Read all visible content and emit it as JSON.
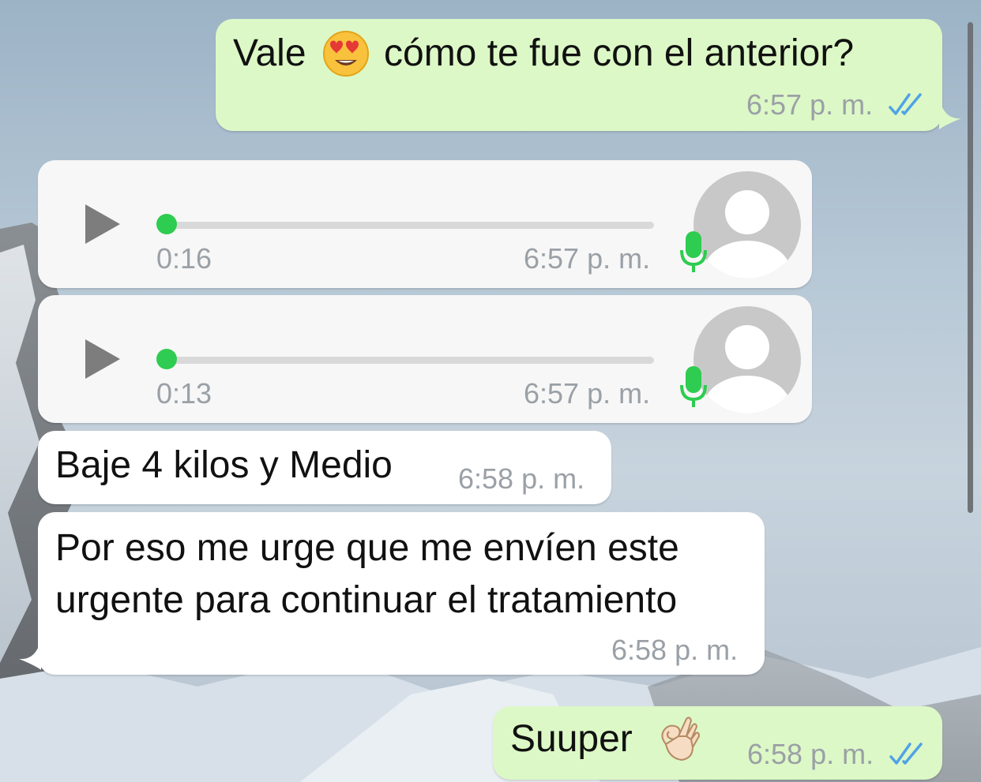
{
  "colors": {
    "outgoing_bubble": "#dcf8c6",
    "incoming_bubble": "#ffffff",
    "read_ticks": "#4fa3e6",
    "progress_dot": "#2ecc50",
    "mic_icon": "#2ecc50",
    "timestamp": "#9aa0a6"
  },
  "messages": [
    {
      "kind": "text",
      "direction": "outgoing",
      "text_before_emoji": "Vale",
      "emoji": "heart-eyes-emoji",
      "text_after_emoji": "cómo te fue con el anterior?",
      "time": "6:57 p. m.",
      "status": "read"
    },
    {
      "kind": "voice",
      "direction": "incoming",
      "duration": "0:16",
      "time": "6:57 p. m.",
      "progress": 0
    },
    {
      "kind": "voice",
      "direction": "incoming",
      "duration": "0:13",
      "time": "6:57 p. m.",
      "progress": 0
    },
    {
      "kind": "text",
      "direction": "incoming",
      "text": "Baje 4 kilos y Medio",
      "time": "6:58 p. m."
    },
    {
      "kind": "text",
      "direction": "incoming",
      "line1": "Por eso me urge que me envíen este",
      "line2": "urgente para continuar el tratamiento",
      "time": "6:58 p. m."
    },
    {
      "kind": "text",
      "direction": "outgoing",
      "text": "Suuper",
      "emoji": "ok-hand-emoji",
      "time": "6:58 p. m.",
      "status": "read"
    }
  ]
}
